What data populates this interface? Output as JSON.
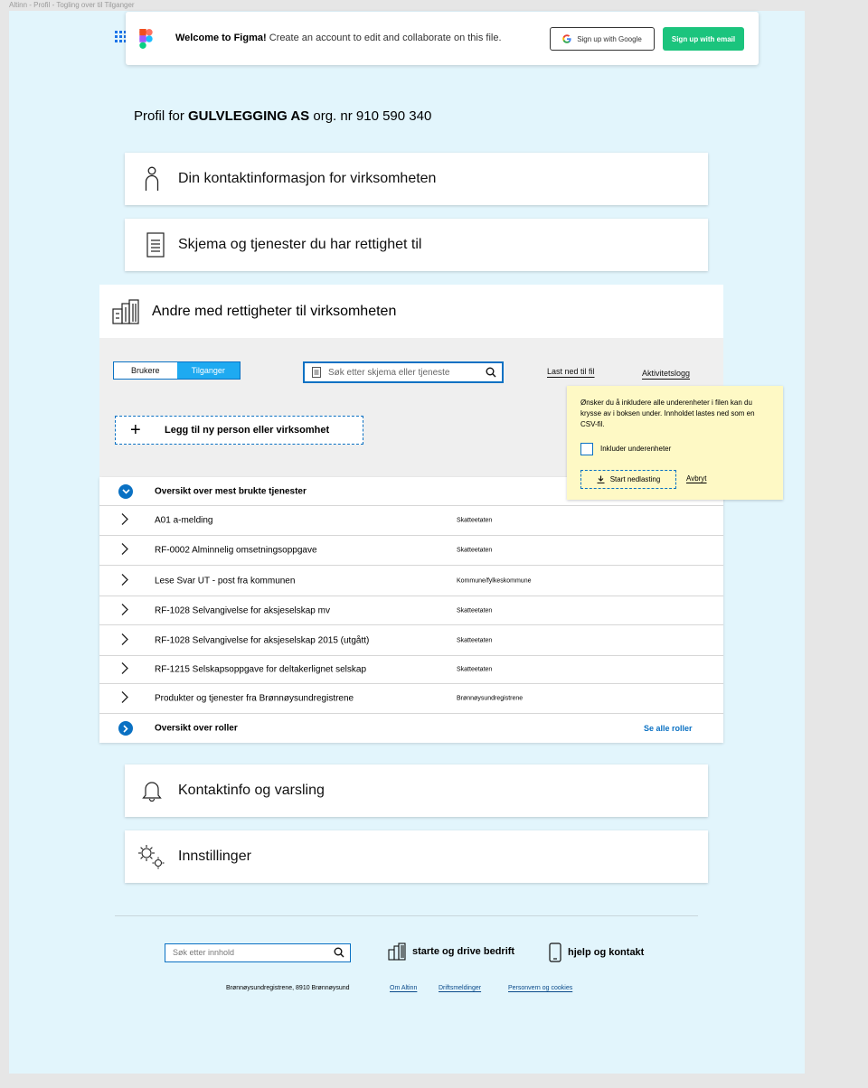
{
  "frame_title": "Altinn - Profil - Togling over til Tilganger",
  "banner": {
    "welcome": "Welcome to Figma!",
    "message": " Create an account to edit and collaborate on this file.",
    "google_btn": "Sign up with Google",
    "email_btn": "Sign up with email"
  },
  "profile": {
    "prefix": "Profil for ",
    "company": "GULVLEGGING AS",
    "suffix": " org. nr 910 590 340"
  },
  "sections": {
    "contact_info": "Din kontaktinformasjon for virksomheten",
    "forms": "Skjema og tjenester du har rettighet til",
    "others": "Andre med rettigheter til virksomheten",
    "notifications": "Kontaktinfo og varsling",
    "settings": "Innstillinger"
  },
  "toggle": {
    "users": "Brukere",
    "access": "Tilganger",
    "active": "access"
  },
  "search": {
    "placeholder": "Søk etter skjema eller tjeneste"
  },
  "links": {
    "download": "Last ned til fil",
    "activity": "Aktivitetslogg"
  },
  "add_button": "Legg til ny person eller virksomhet",
  "popup": {
    "message": "Ønsker du å inkludere alle underenheter i filen kan du krysse av i boksen under. Innholdet lastes ned som en CSV-fil.",
    "checkbox_label": "Inkluder underenheter",
    "checkbox_checked": false,
    "start_btn": "Start nedlasting",
    "cancel": "Avbryt"
  },
  "list": {
    "header": "Oversikt over mest brukte tjenester",
    "rows": [
      {
        "name": "A01 a-melding",
        "owner": "Skatteetaten"
      },
      {
        "name": "RF-0002 Alminnelig omsetningsoppgave",
        "owner": "Skatteetaten"
      },
      {
        "name": "Lese Svar UT - post fra kommunen",
        "owner": "Kommune/fylkeskommune"
      },
      {
        "name": "RF-1028 Selvangivelse for aksjeselskap mv",
        "owner": "Skatteetaten"
      },
      {
        "name": "RF-1028 Selvangivelse for aksjeselskap 2015 (utgått)",
        "owner": "Skatteetaten"
      },
      {
        "name": "RF-1215 Selskapsoppgave for deltakerlignet selskap",
        "owner": "Skatteetaten"
      },
      {
        "name": "Produkter og tjenester fra Brønnøysundregistrene",
        "owner": "Brønnøysundregistrene"
      }
    ],
    "roles_label": "Oversikt over roller",
    "see_all_roles": "Se alle roller"
  },
  "footer": {
    "search_placeholder": "Søk etter innhold",
    "business": "starte og drive bedrift",
    "help": "hjelp og kontakt",
    "address": "Brønnøysundregistrene, 8910 Brønnøysund",
    "about": "Om Altinn",
    "status": "Driftsmeldinger",
    "privacy": "Personvern og cookies"
  },
  "colors": {
    "accent": "#0a71c3",
    "toggle_active": "#1eaaf1",
    "figma_green": "#1bc47d",
    "popup_bg": "#fef9c5",
    "frame_bg": "#e2f5fc"
  }
}
